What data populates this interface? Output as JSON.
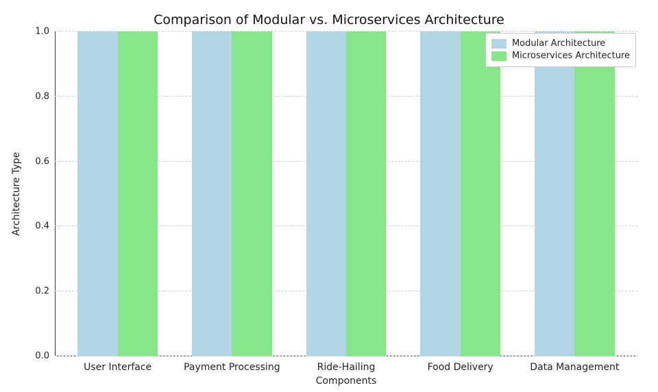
{
  "chart_data": {
    "type": "bar",
    "title": "Comparison of Modular vs. Microservices Architecture",
    "xlabel": "Components",
    "ylabel": "Architecture Type",
    "categories": [
      "User Interface",
      "Payment Processing",
      "Ride-Hailing",
      "Food Delivery",
      "Data Management"
    ],
    "series": [
      {
        "name": "Modular Architecture",
        "values": [
          1,
          1,
          1,
          1,
          1
        ],
        "color": "#b2d6e6"
      },
      {
        "name": "Microservices Architecture",
        "values": [
          1,
          1,
          1,
          1,
          1
        ],
        "color": "#89e589"
      }
    ],
    "ylim": [
      0.0,
      1.0
    ],
    "yticks": [
      0.0,
      0.2,
      0.4,
      0.6,
      0.8,
      1.0
    ],
    "ytick_labels": [
      "0.0",
      "0.2",
      "0.4",
      "0.6",
      "0.8",
      "1.0"
    ],
    "grid": true,
    "legend_position": "upper-right"
  }
}
